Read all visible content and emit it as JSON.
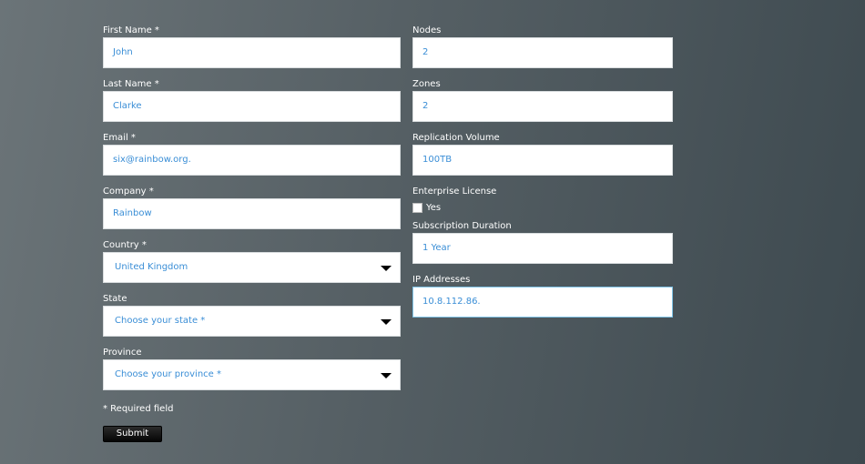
{
  "form": {
    "left": [
      {
        "label": "First Name *",
        "value": "John"
      },
      {
        "label": "Last Name *",
        "value": "Clarke"
      },
      {
        "label": "Email *",
        "value": "six@rainbow.org."
      },
      {
        "label": "Company *",
        "value": "Rainbow"
      },
      {
        "label": "Country *",
        "value": "United Kingdom"
      },
      {
        "label": "State",
        "value": "Choose your state *"
      },
      {
        "label": "Province",
        "value": "Choose your province *"
      }
    ],
    "right": [
      {
        "label": "Nodes",
        "value": "2"
      },
      {
        "label": "Zones",
        "value": "2"
      },
      {
        "label": "Replication Volume",
        "value": "100TB"
      },
      {
        "label": "Enterprise License",
        "checkbox_label": "Yes",
        "checked": false
      },
      {
        "label": "Subscription Duration",
        "value": "1 Year"
      },
      {
        "label": "IP Addresses",
        "value": "10.8.112.86."
      }
    ],
    "required_note": "* Required field",
    "submit_label": "Submit"
  },
  "colors": {
    "input_text": "#3a8ed6",
    "label_text": "#ffffff",
    "focus_border": "#7fc3e6",
    "background_start": "#6b7478",
    "background_end": "#3d494f"
  },
  "icons": {
    "select_caret": "chevron-down-icon"
  }
}
